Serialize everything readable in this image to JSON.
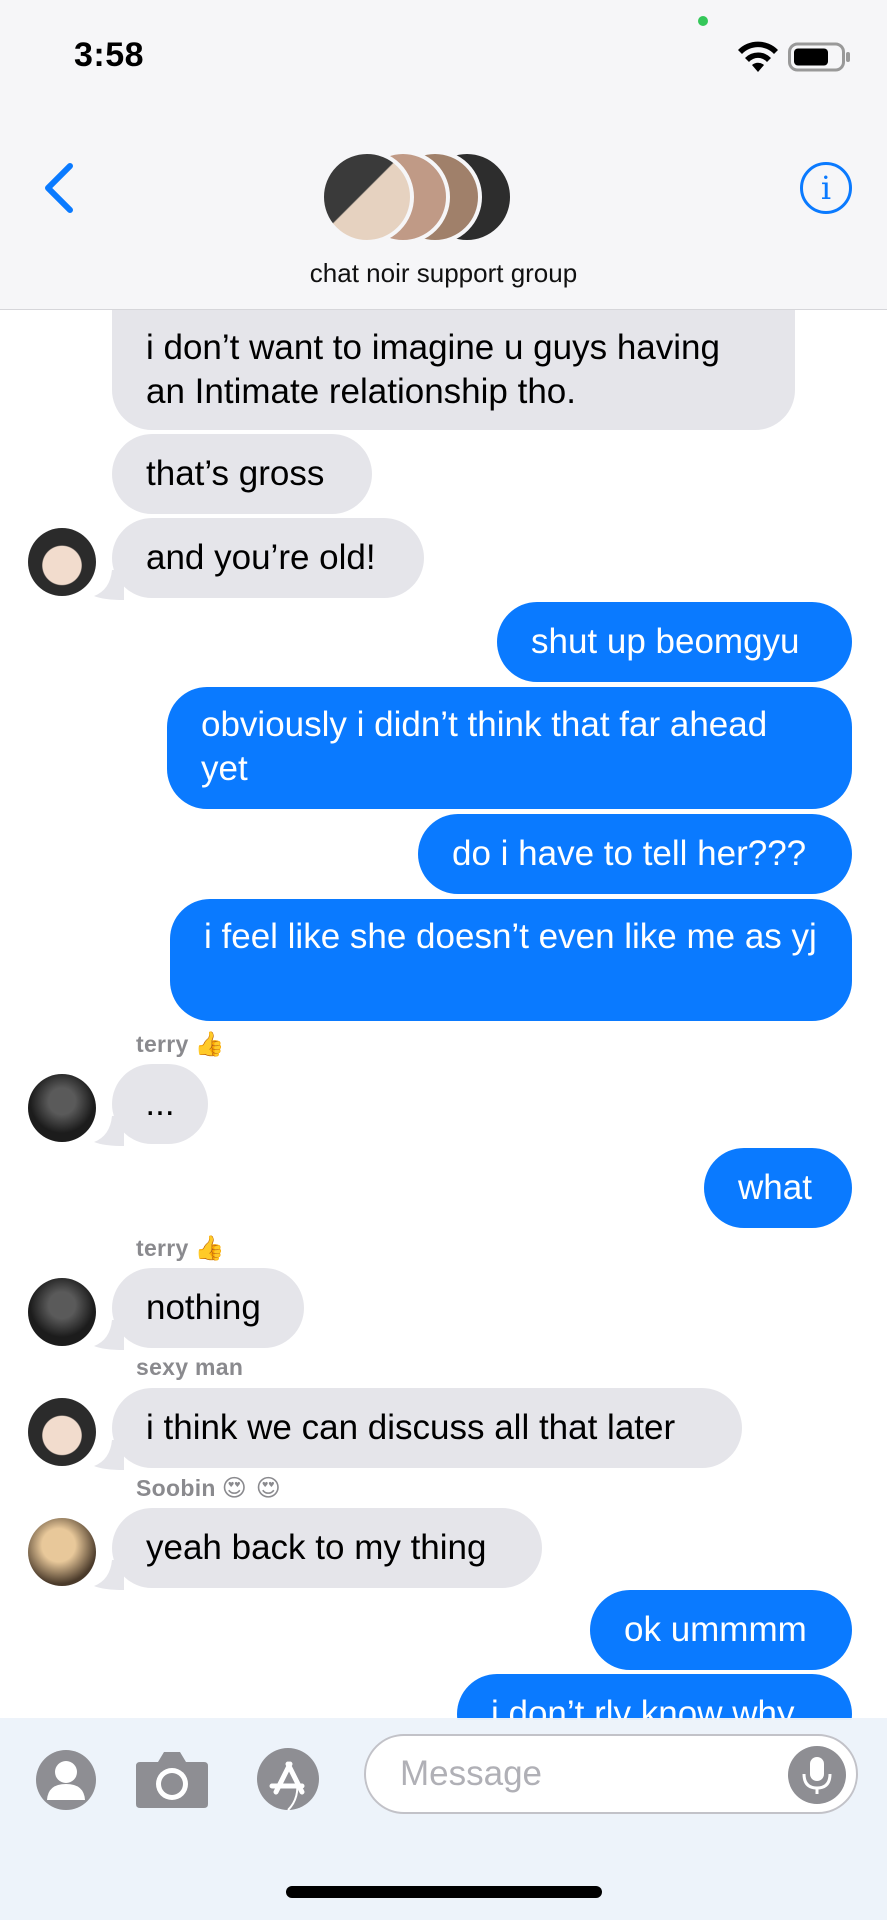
{
  "status": {
    "time": "3:58"
  },
  "header": {
    "group_name": "chat noir support group",
    "back_icon": "chevron-left-icon",
    "info_icon": "info-icon",
    "info_glyph": "i"
  },
  "messages": [
    {
      "dir": "in",
      "text": "i don’t want to imagine u guys having an Intimate relationship tho."
    },
    {
      "dir": "in",
      "text": "that’s gross"
    },
    {
      "dir": "in",
      "text": "and you’re old!"
    },
    {
      "dir": "out",
      "text": "shut up beomgyu"
    },
    {
      "dir": "out",
      "text": "obviously i didn’t think that far ahead yet"
    },
    {
      "dir": "out",
      "text": "do i have to tell her???"
    },
    {
      "dir": "out",
      "text": "i feel like she doesn’t even like me as yj"
    },
    {
      "dir": "in",
      "sender": "terry",
      "sender_emoji": "👍",
      "text": "..."
    },
    {
      "dir": "out",
      "text": "what"
    },
    {
      "dir": "in",
      "sender": "terry",
      "sender_emoji": "👍",
      "text": "nothing"
    },
    {
      "dir": "in",
      "sender": "sexy man",
      "text": "i think we can discuss all that later"
    },
    {
      "dir": "in",
      "sender": "Soobin",
      "sender_emoji": "😍 😍",
      "text": "yeah back to my thing"
    },
    {
      "dir": "out",
      "text": "ok ummmm"
    },
    {
      "dir": "out",
      "text": "i don’t rly know why"
    }
  ],
  "composer": {
    "placeholder": "Message"
  },
  "colors": {
    "accent": "#0a7aff",
    "incoming": "#e5e5ea",
    "meta": "#8a8a8e"
  }
}
